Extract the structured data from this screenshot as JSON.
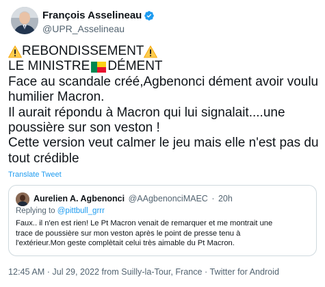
{
  "author": {
    "name": "François Asselineau",
    "handle": "@UPR_Asselineau",
    "verified_color": "#1d9bf0"
  },
  "tweet": {
    "lines": [
      "REBONDISSEMENT",
      "LE MINISTRE",
      "DÉMENT",
      "Face au scandale créé,Agbenonci dément avoir voulu",
      "humilier Macron.",
      "Il aurait répondu à Macron qui lui signalait....une",
      "poussière sur son veston !",
      "Cette version veut calmer le jeu mais elle n'est pas du",
      "tout crédible"
    ],
    "warning_icon": "warning-emoji",
    "flag_icon": "benin-flag-emoji",
    "translate_label": "Translate Tweet"
  },
  "quote": {
    "name": "Aurelien A. Agbenonci",
    "handle": "@AAgbenonciMAEC",
    "separator": "·",
    "time": "20h",
    "replying_prefix": "Replying to",
    "replying_mention": "@pittbull_grrr",
    "lines": [
      "Faux..  il n'en est rien! Le Pt Macron venait de remarquer et me montrait une",
      "trace de  poussière sur mon veston  après le point de presse  tenu à",
      "l'extérieur.Mon geste complètait celui très aimable du Pt Macron."
    ]
  },
  "meta": {
    "time": "12:45 AM",
    "date": "Jul 29, 2022",
    "location": "from Suilly-la-Tour, France",
    "app": "Twitter for Android",
    "sep": " · "
  },
  "colors": {
    "accent": "#1d9bf0",
    "secondary_text": "#536471",
    "border": "#cfd9de"
  }
}
